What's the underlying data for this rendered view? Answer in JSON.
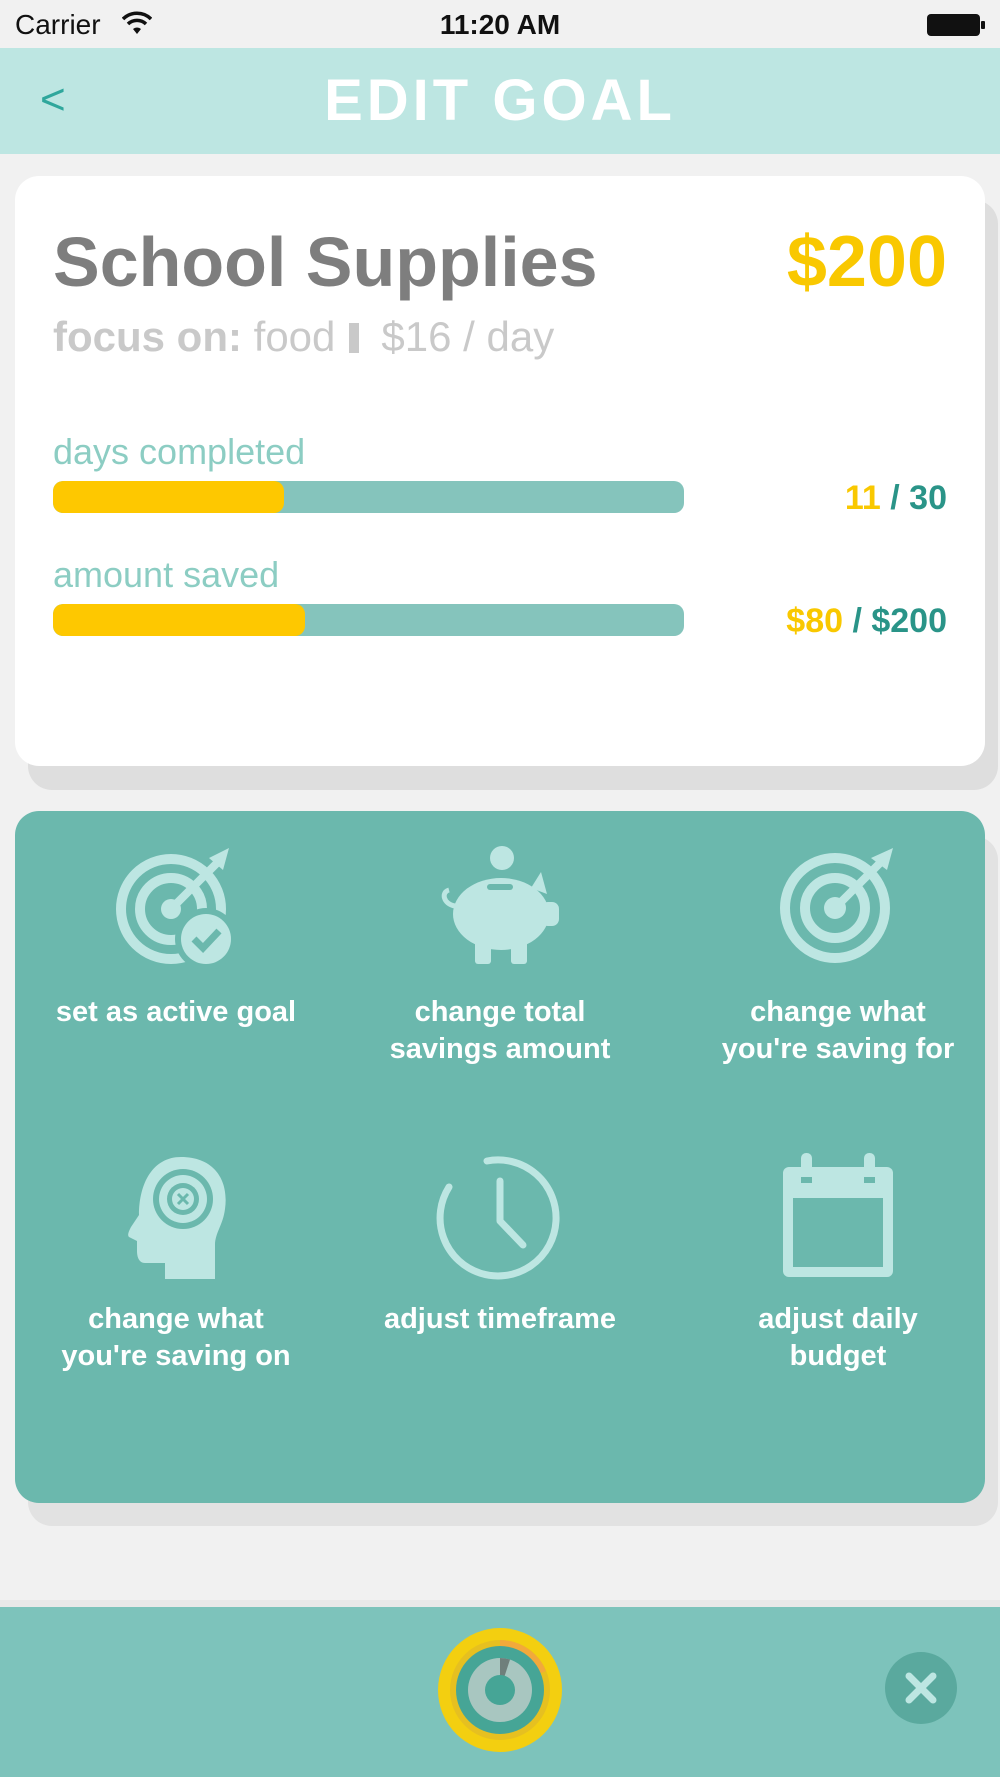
{
  "status_bar": {
    "carrier": "Carrier",
    "time": "11:20 AM"
  },
  "header": {
    "back_label": "<",
    "title": "EDIT GOAL"
  },
  "goal": {
    "name": "School Supplies",
    "amount": "$200",
    "focus_label": "focus on:",
    "focus_category": "food",
    "daily_budget": "$16 / day",
    "days": {
      "label": "days completed",
      "current": "11",
      "separator": " / ",
      "total": "30",
      "fraction": 0.366
    },
    "saved": {
      "label": "amount saved",
      "current": "$80",
      "separator": " / ",
      "total": "$200",
      "fraction": 0.4
    }
  },
  "actions": [
    {
      "label": "set as active goal",
      "icon": "target-check-icon"
    },
    {
      "label": "change total savings amount",
      "icon": "piggy-bank-icon"
    },
    {
      "label": "change what you're saving for",
      "icon": "target-icon"
    },
    {
      "label": "change what you're saving on",
      "icon": "head-target-icon"
    },
    {
      "label": "adjust timeframe",
      "icon": "clock-icon"
    },
    {
      "label": "adjust daily budget",
      "icon": "calendar-icon"
    }
  ],
  "colors": {
    "header_bg": "#bde6e2",
    "accent_teal": "#6bb8ad",
    "accent_yellow": "#fec800",
    "icon_light": "#bde6e2"
  }
}
